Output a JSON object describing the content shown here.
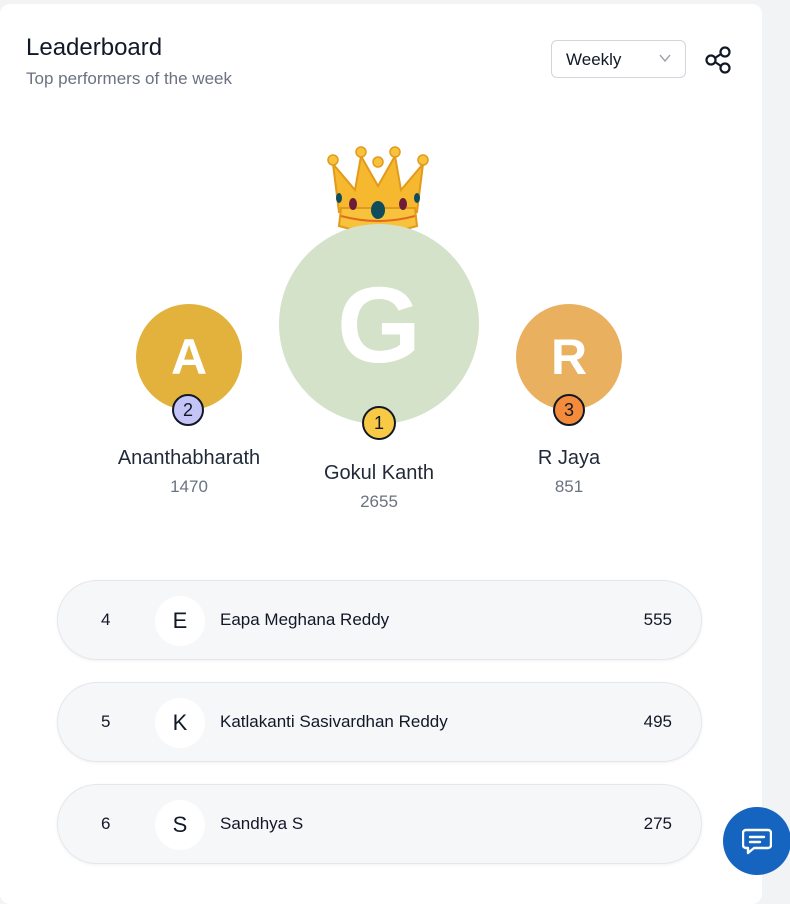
{
  "header": {
    "title": "Leaderboard",
    "subtitle": "Top performers of the week",
    "period_select": {
      "selected": "Weekly"
    },
    "share_icon": "share-icon"
  },
  "podium": [
    {
      "rank": "1",
      "initial": "G",
      "name": "Gokul Kanth",
      "score": "2655",
      "avatar_color": "#d3e2c9",
      "badge_color": "#f8c945",
      "crown": true
    },
    {
      "rank": "2",
      "initial": "A",
      "name": "Ananthabharath",
      "score": "1470",
      "avatar_color": "#e2b23c",
      "badge_color": "#c4c4f6"
    },
    {
      "rank": "3",
      "initial": "R",
      "name": "R Jaya",
      "score": "851",
      "avatar_color": "#e9b05f",
      "badge_color": "#f48b3b"
    }
  ],
  "list": [
    {
      "rank": "4",
      "initial": "E",
      "name": "Eapa Meghana Reddy",
      "score": "555"
    },
    {
      "rank": "5",
      "initial": "K",
      "name": "Katlakanti Sasivardhan Reddy",
      "score": "495"
    },
    {
      "rank": "6",
      "initial": "S",
      "name": "Sandhya S",
      "score": "275"
    }
  ],
  "chat_button": {
    "icon": "chat-icon",
    "color": "#1565c0"
  }
}
